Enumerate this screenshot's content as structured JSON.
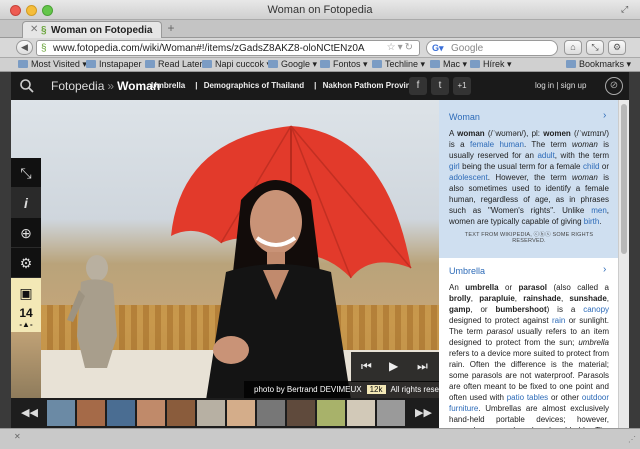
{
  "window": {
    "title": "Woman on Fotopedia"
  },
  "tab": {
    "title": "Woman on Fotopedia",
    "new_tab": "+"
  },
  "nav": {
    "url": "www.fotopedia.com/wiki/Woman#!/items/zGadsZ8AKZ8-oloNCtENz0A",
    "search_placeholder": "Google"
  },
  "bookmarks": {
    "items": [
      "Most Visited ▾",
      "Instapaper",
      "Read Later",
      "Napi cuccok ▾",
      "Google ▾",
      "Fontos ▾",
      "Techline ▾",
      "Mac ▾",
      "Hírek ▾"
    ],
    "right": "Bookmarks ▾"
  },
  "site": {
    "brand": "Fotopedia",
    "section": "Woman",
    "breadcrumbs": [
      "Umbrella",
      "Demographics of Thailand",
      "Nakhon Pathom Province"
    ],
    "login": "log in | sign up",
    "plus_one": "+1"
  },
  "photo": {
    "counter": "14",
    "credit": "photo by Bertrand DEVIMEUX",
    "license_badge": "12k",
    "rights": "All rights reserved."
  },
  "panel": {
    "card1": {
      "heading": "Woman",
      "attribution": "TEXT FROM WIKIPEDIA, ⓒⓑⓢ SOME RIGHTS RESERVED."
    },
    "card2": {
      "heading": "Umbrella"
    }
  },
  "colors": {
    "link": "#2d6bb8",
    "panel_highlight": "#cfdff0",
    "site_header": "#1a1a1a",
    "umbrella": "#e53b2d"
  }
}
